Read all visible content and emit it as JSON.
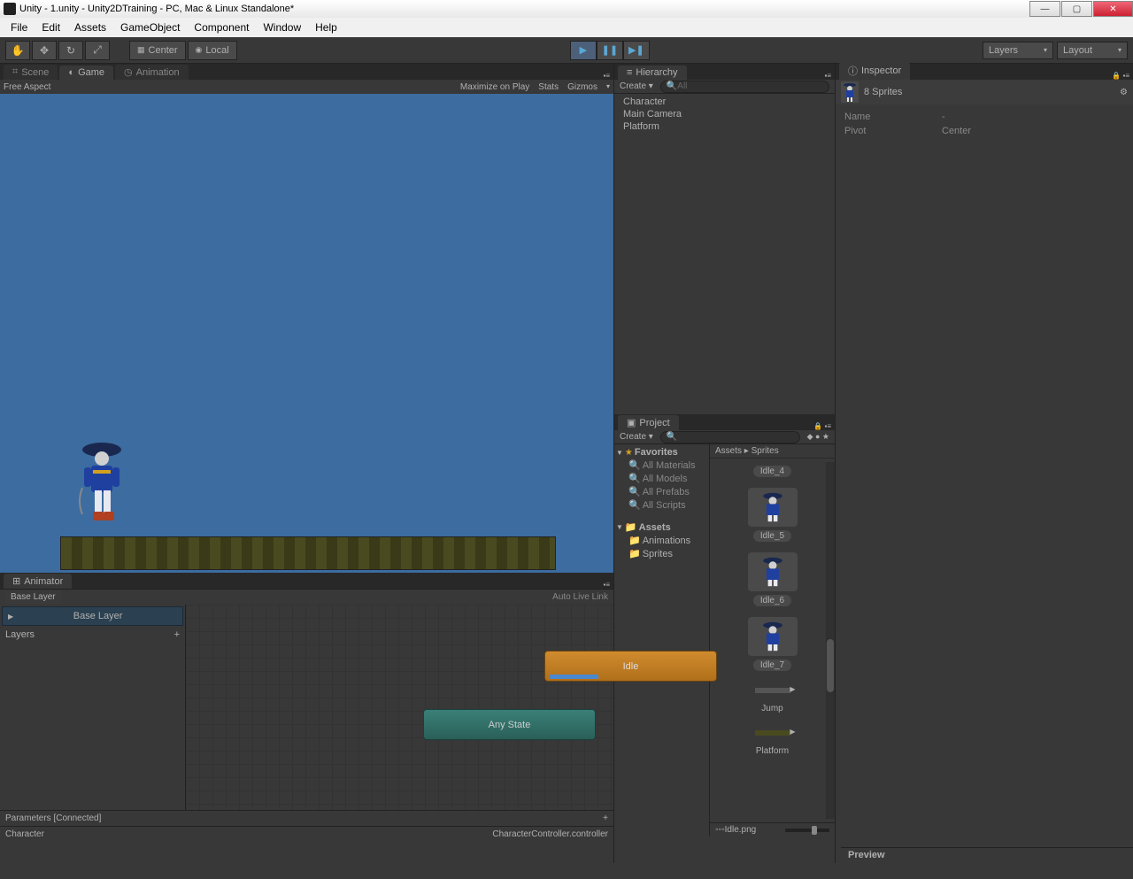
{
  "title": "Unity - 1.unity - Unity2DTraining - PC, Mac & Linux Standalone*",
  "menu": [
    "File",
    "Edit",
    "Assets",
    "GameObject",
    "Component",
    "Window",
    "Help"
  ],
  "toolbar": {
    "center": "Center",
    "local": "Local",
    "layers": "Layers",
    "layout": "Layout"
  },
  "tabs": {
    "scene": "Scene",
    "game": "Game",
    "animation": "Animation",
    "animator": "Animator",
    "hierarchy": "Hierarchy",
    "project": "Project",
    "inspector": "Inspector"
  },
  "game_toolbar": {
    "aspect": "Free Aspect",
    "maximize": "Maximize on Play",
    "stats": "Stats",
    "gizmos": "Gizmos"
  },
  "animator": {
    "breadcrumb": "Base Layer",
    "autolive": "Auto Live Link",
    "base_layer": "Base Layer",
    "layers_label": "Layers",
    "idle_state": "Idle",
    "any_state": "Any State",
    "parameters": "Parameters [Connected]",
    "footer_left": "Character",
    "footer_right": "CharacterController.controller"
  },
  "hierarchy": {
    "create": "Create",
    "search_placeholder": "All",
    "items": [
      "Character",
      "Main Camera",
      "Platform"
    ]
  },
  "project": {
    "create": "Create",
    "favorites": "Favorites",
    "all_materials": "All Materials",
    "all_models": "All Models",
    "all_prefabs": "All Prefabs",
    "all_scripts": "All Scripts",
    "assets": "Assets",
    "animations": "Animations",
    "sprites": "Sprites",
    "crumb": "Assets ▸ Sprites",
    "items": [
      "Idle_4",
      "Idle_5",
      "Idle_6",
      "Idle_7",
      "Jump",
      "Platform"
    ],
    "footer": "Idle.png"
  },
  "inspector": {
    "title": "8 Sprites",
    "name_label": "Name",
    "name_val": "-",
    "pivot_label": "Pivot",
    "pivot_val": "Center",
    "preview": "Preview"
  }
}
